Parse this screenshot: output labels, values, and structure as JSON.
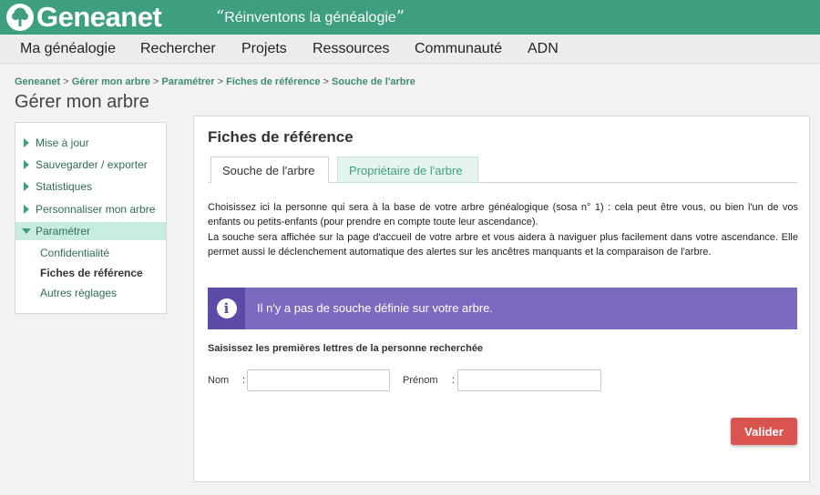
{
  "header": {
    "logo_text": "Geneanet",
    "slogan_open": "“",
    "slogan": "Réinventons la généalogie",
    "slogan_close": "”",
    "colors": {
      "brand": "#3d9f7f",
      "alert": "#7c69c0",
      "button": "#d9534f"
    }
  },
  "nav": {
    "items": [
      {
        "label": "Ma généalogie"
      },
      {
        "label": "Rechercher"
      },
      {
        "label": "Projets"
      },
      {
        "label": "Ressources"
      },
      {
        "label": "Communauté"
      },
      {
        "label": "ADN"
      }
    ]
  },
  "breadcrumb": {
    "items": [
      {
        "label": "Geneanet"
      },
      {
        "label": "Gérer mon arbre"
      },
      {
        "label": "Paramétrer"
      },
      {
        "label": "Fiches de référence"
      },
      {
        "label": "Souche de l'arbre"
      }
    ],
    "separator": ">"
  },
  "page_title": "Gérer mon arbre",
  "sidebar": {
    "items": [
      {
        "label": "Mise à jour"
      },
      {
        "label": "Sauvegarder / exporter"
      },
      {
        "label": "Statistiques"
      },
      {
        "label": "Personnaliser mon arbre"
      },
      {
        "label": "Paramétrer"
      }
    ],
    "subitems": [
      {
        "label": "Confidentialité"
      },
      {
        "label": "Fiches de référence"
      },
      {
        "label": "Autres réglages"
      }
    ]
  },
  "main": {
    "title": "Fiches de référence",
    "tabs": [
      {
        "label": "Souche de l'arbre"
      },
      {
        "label": "Propriétaire de l'arbre"
      }
    ],
    "description_1": "Choisissez ici la personne qui sera à la base de votre arbre généalogique (sosa n° 1) : cela peut être vous, ou bien l'un de vos enfants ou petits-enfants (pour prendre en compte toute leur ascendance).",
    "description_2": "La souche sera affichée sur la page d'accueil de votre arbre et vous aidera à naviguer plus facilement dans votre ascendance. Elle permet aussi le déclenchement automatique des alertes sur les ancêtres manquants et la comparaison de l'arbre.",
    "alert": {
      "icon": "info-icon",
      "icon_glyph": "i",
      "text": "Il n'y a pas de souche définie sur votre arbre."
    },
    "search_label": "Saisissez les premières lettres de la personne recherchée",
    "fields": {
      "nom_label": "Nom",
      "prenom_label": "Prénom",
      "colon": ":",
      "nom_value": "",
      "prenom_value": ""
    },
    "submit_label": "Valider"
  }
}
